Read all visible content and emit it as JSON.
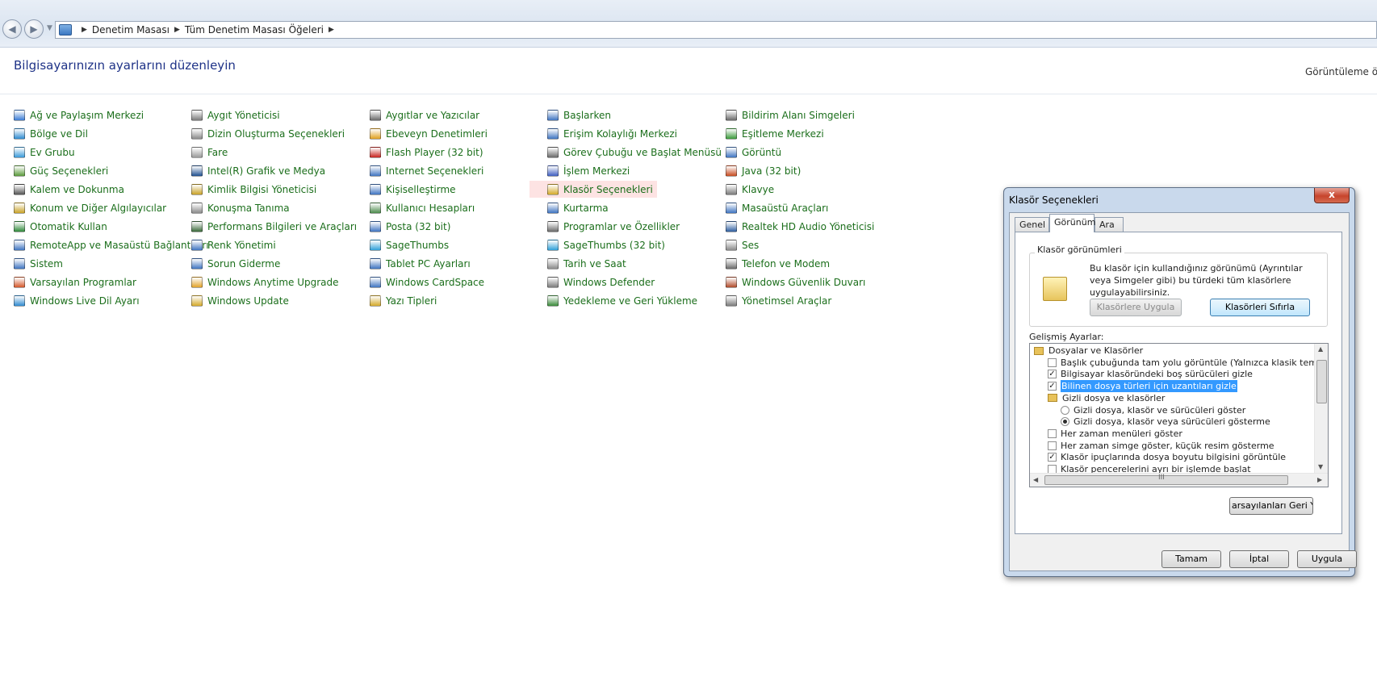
{
  "address_bar": {
    "back_icon": "back-arrow-icon",
    "forward_icon": "forward-arrow-icon",
    "breadcrumbs": [
      "Denetim Masası",
      "Tüm Denetim Masası Öğeleri"
    ]
  },
  "header": {
    "title": "Bilgisayarınızın ayarlarını düzenleyin",
    "view_by": "Görüntüleme ölç"
  },
  "columns": [
    [
      {
        "label": "Ağ ve Paylaşım Merkezi",
        "icon": "network-icon",
        "color": "#3a7bd5"
      },
      {
        "label": "Bölge ve Dil",
        "icon": "globe-clock-icon",
        "color": "#2e8bd0"
      },
      {
        "label": "Ev Grubu",
        "icon": "homegroup-icon",
        "color": "#3a9ad9"
      },
      {
        "label": "Güç Seçenekleri",
        "icon": "power-options-icon",
        "color": "#5a9a3a"
      },
      {
        "label": "Kalem ve Dokunma",
        "icon": "pen-icon",
        "color": "#555555"
      },
      {
        "label": "Konum ve Diğer Algılayıcılar",
        "icon": "sensor-icon",
        "color": "#c9a227"
      },
      {
        "label": "Otomatik Kullan",
        "icon": "autoplay-icon",
        "color": "#2f8a3a"
      },
      {
        "label": "RemoteApp ve Masaüstü Bağlantıları",
        "icon": "remoteapp-icon",
        "color": "#3f74c1"
      },
      {
        "label": "Sistem",
        "icon": "system-icon",
        "color": "#3f74c1"
      },
      {
        "label": "Varsayılan Programlar",
        "icon": "default-programs-icon",
        "color": "#d4572a"
      },
      {
        "label": "Windows Live Dil Ayarı",
        "icon": "live-language-icon",
        "color": "#2f8ad0"
      }
    ],
    [
      {
        "label": "Aygıt Yöneticisi",
        "icon": "device-manager-icon",
        "color": "#7a7a7a"
      },
      {
        "label": "Dizin Oluşturma Seçenekleri",
        "icon": "indexing-icon",
        "color": "#8a8a8a"
      },
      {
        "label": "Fare",
        "icon": "mouse-icon",
        "color": "#9a9a9a"
      },
      {
        "label": "Intel(R) Grafik ve Medya",
        "icon": "intel-graphics-icon",
        "color": "#1f4f8f"
      },
      {
        "label": "Kimlik Bilgisi Yöneticisi",
        "icon": "credential-icon",
        "color": "#c9a227"
      },
      {
        "label": "Konuşma Tanıma",
        "icon": "microphone-icon",
        "color": "#8a8a8a"
      },
      {
        "label": "Performans Bilgileri ve Araçları",
        "icon": "performance-icon",
        "color": "#3a6a3a"
      },
      {
        "label": "Renk Yönetimi",
        "icon": "color-management-icon",
        "color": "#3f74c1"
      },
      {
        "label": "Sorun Giderme",
        "icon": "troubleshoot-icon",
        "color": "#3f74c1"
      },
      {
        "label": "Windows Anytime Upgrade",
        "icon": "windows-flag-icon",
        "color": "#e2a32a"
      },
      {
        "label": "Windows Update",
        "icon": "windows-update-icon",
        "color": "#d4a92a"
      }
    ],
    [
      {
        "label": "Aygıtlar ve Yazıcılar",
        "icon": "printer-icon",
        "color": "#6a6a6a"
      },
      {
        "label": "Ebeveyn Denetimleri",
        "icon": "parental-controls-icon",
        "color": "#e0a020"
      },
      {
        "label": "Flash Player (32 bit)",
        "icon": "flash-icon",
        "color": "#c8241f"
      },
      {
        "label": "Internet Seçenekleri",
        "icon": "internet-options-icon",
        "color": "#3f74c1"
      },
      {
        "label": "Kişiselleştirme",
        "icon": "personalization-icon",
        "color": "#3f74c1"
      },
      {
        "label": "Kullanıcı Hesapları",
        "icon": "user-accounts-icon",
        "color": "#4a8a4a"
      },
      {
        "label": "Posta (32 bit)",
        "icon": "mail-icon",
        "color": "#3f74c1"
      },
      {
        "label": "SageThumbs",
        "icon": "sagethumbs-icon",
        "color": "#2fa0d8"
      },
      {
        "label": "Tablet PC Ayarları",
        "icon": "tablet-icon",
        "color": "#3f74c1"
      },
      {
        "label": "Windows CardSpace",
        "icon": "cardspace-icon",
        "color": "#3f74c1"
      },
      {
        "label": "Yazı Tipleri",
        "icon": "fonts-icon",
        "color": "#d4a92a"
      }
    ],
    [
      {
        "label": "Başlarken",
        "icon": "getting-started-icon",
        "color": "#3f74c1"
      },
      {
        "label": "Erişim Kolaylığı Merkezi",
        "icon": "ease-of-access-icon",
        "color": "#3f74c1"
      },
      {
        "label": "Görev Çubuğu ve Başlat Menüsü",
        "icon": "taskbar-icon",
        "color": "#6a6a6a"
      },
      {
        "label": "İşlem Merkezi",
        "icon": "action-center-flag-icon",
        "color": "#3f5fc1"
      },
      {
        "label": "Klasör Seçenekleri",
        "icon": "folder-options-icon",
        "color": "#d4a92a"
      },
      {
        "label": "Kurtarma",
        "icon": "recovery-icon",
        "color": "#3f74c1"
      },
      {
        "label": "Programlar ve Özellikler",
        "icon": "programs-icon",
        "color": "#6a6a6a"
      },
      {
        "label": "SageThumbs (32 bit)",
        "icon": "sagethumbs-icon",
        "color": "#2fa0d8"
      },
      {
        "label": "Tarih ve Saat",
        "icon": "clock-icon",
        "color": "#8a8a8a"
      },
      {
        "label": "Windows Defender",
        "icon": "defender-icon",
        "color": "#7a7a7a"
      },
      {
        "label": "Yedekleme ve Geri Yükleme",
        "icon": "backup-icon",
        "color": "#3a8a3a"
      }
    ],
    [
      {
        "label": "Bildirim Alanı Simgeleri",
        "icon": "notification-icon",
        "color": "#6a6a6a"
      },
      {
        "label": "Eşitleme Merkezi",
        "icon": "sync-icon",
        "color": "#3a9a3a"
      },
      {
        "label": "Görüntü",
        "icon": "display-icon",
        "color": "#3f74c1"
      },
      {
        "label": "Java (32 bit)",
        "icon": "java-icon",
        "color": "#c84a1f"
      },
      {
        "label": "Klavye",
        "icon": "keyboard-icon",
        "color": "#7a7a7a"
      },
      {
        "label": "Masaüstü Araçları",
        "icon": "gadgets-icon",
        "color": "#3f74c1"
      },
      {
        "label": "Realtek HD Audio Yöneticisi",
        "icon": "realtek-icon",
        "color": "#2f5fa0"
      },
      {
        "label": "Ses",
        "icon": "speaker-icon",
        "color": "#8a8a8a"
      },
      {
        "label": "Telefon ve Modem",
        "icon": "phone-modem-icon",
        "color": "#6a6a6a"
      },
      {
        "label": "Windows Güvenlik Duvarı",
        "icon": "firewall-icon",
        "color": "#b04a2a"
      },
      {
        "label": "Yönetimsel Araçlar",
        "icon": "admin-tools-icon",
        "color": "#7a7a7a"
      }
    ]
  ],
  "highlighted_item": "Klasör Seçenekleri",
  "dialog": {
    "title": "Klasör Seçenekleri",
    "close_label": "x",
    "tabs": [
      "Genel",
      "Görünüm",
      "Ara"
    ],
    "active_tab": "Görünüm",
    "folder_views": {
      "title": "Klasör görünümleri",
      "description": "Bu klasör için kullandığınız görünümü (Ayrıntılar veya Simgeler gibi) bu türdeki tüm klasörlere uygulayabilirsiniz.",
      "apply_button": "Klasörlere Uygula",
      "reset_button": "Klasörleri Sıfırla"
    },
    "advanced_label": "Gelişmiş Ayarlar:",
    "advanced_items": [
      {
        "type": "folder",
        "label": "Dosyalar ve Klasörler",
        "indent": 0
      },
      {
        "type": "checkbox",
        "label": "Başlık çubuğunda tam yolu görüntüle (Yalnızca klasik tema)",
        "checked": false,
        "indent": 1
      },
      {
        "type": "checkbox",
        "label": "Bilgisayar klasöründeki boş sürücüleri gizle",
        "checked": true,
        "indent": 1
      },
      {
        "type": "checkbox",
        "label": "Bilinen dosya türleri için uzantıları gizle",
        "checked": true,
        "indent": 1,
        "selected": true
      },
      {
        "type": "folder",
        "label": "Gizli dosya ve klasörler",
        "indent": 1
      },
      {
        "type": "radio",
        "label": "Gizli dosya, klasör ve sürücüleri göster",
        "checked": false,
        "indent": 2
      },
      {
        "type": "radio",
        "label": "Gizli dosya, klasör veya sürücüleri gösterme",
        "checked": true,
        "indent": 2
      },
      {
        "type": "checkbox",
        "label": "Her zaman menüleri göster",
        "checked": false,
        "indent": 1
      },
      {
        "type": "checkbox",
        "label": "Her zaman simge göster, küçük resim gösterme",
        "checked": false,
        "indent": 1
      },
      {
        "type": "checkbox",
        "label": "Klasör ipuçlarında dosya boyutu bilgisini görüntüle",
        "checked": true,
        "indent": 1
      },
      {
        "type": "checkbox",
        "label": "Klasör pencerelerini ayrı bir işlemde başlat",
        "checked": false,
        "indent": 1
      }
    ],
    "scroll_grip": "III",
    "restore_button": "arsayılanları Geri Yükl",
    "ok_button": "Tamam",
    "cancel_button": "İptal",
    "apply_button": "Uygula"
  }
}
